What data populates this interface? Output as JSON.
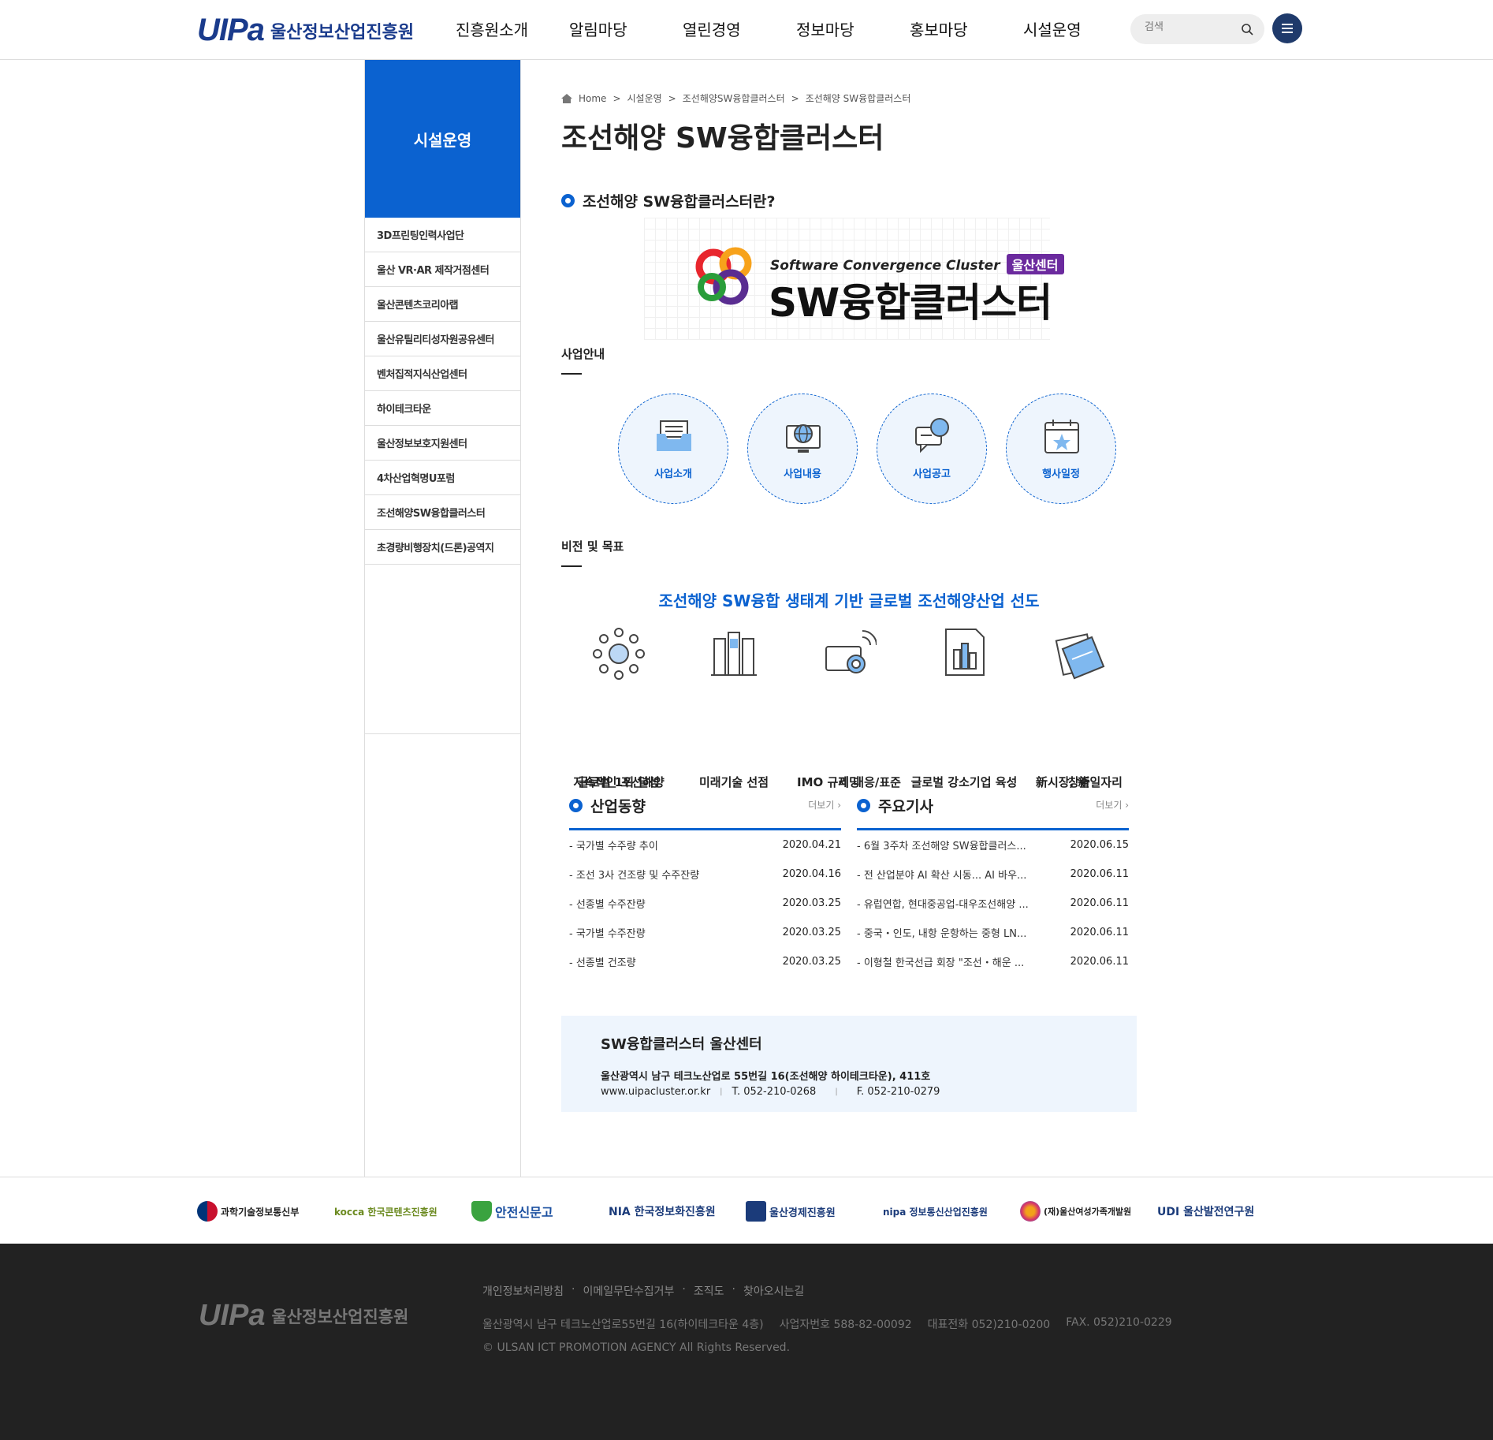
{
  "header": {
    "logo_mark": "UIPa",
    "logo_text": "울산정보산업진흥원",
    "nav": [
      "진흥원소개",
      "알림마당",
      "열린경영",
      "정보마당",
      "홍보마당",
      "시설운영"
    ],
    "search_placeholder": "검색"
  },
  "sidebar": {
    "title": "시설운영",
    "items": [
      "3D프린팅인력사업단",
      "울산 VR·AR 제작거점센터",
      "울산콘텐츠코리아랩",
      "울산유틸리티성자원공유센터",
      "벤처집적지식산업센터",
      "하이테크타운",
      "울산정보보호지원센터",
      "4차산업혁명U포럼",
      "조선해양SW융합클러스터",
      "초경량비행장치(드론)공역지"
    ]
  },
  "breadcrumb": [
    "Home",
    "시설운영",
    "조선해양SW융합클러스터",
    "조선해양 SW융합클러스터"
  ],
  "page_title": "조선해양 SW융합클러스터",
  "intro": {
    "heading": "조선해양 SW융합클러스터란?",
    "banner_sub": "Software Convergence Cluster",
    "banner_tag": "울산센터",
    "banner_main": "SW융합클러스터"
  },
  "business": {
    "heading": "사업안내",
    "items": [
      {
        "label": "사업소개",
        "icon": "inbox-icon"
      },
      {
        "label": "사업내용",
        "icon": "monitor-globe-icon"
      },
      {
        "label": "사업공고",
        "icon": "chat-search-icon"
      },
      {
        "label": "행사일정",
        "icon": "calendar-star-icon"
      }
    ]
  },
  "vision": {
    "heading": "비전 및 목표",
    "statement": "조선해양 SW융합 생태계 기반 글로벌 조선해양산업 선도",
    "goals": [
      {
        "line1": "지속적인 조선해양",
        "line2": "글로벌 1위 달성",
        "icon": "network-icon"
      },
      {
        "line1": "미래기술 선점",
        "line2": "",
        "icon": "books-icon"
      },
      {
        "line1": "IMO 규제 대응/표준",
        "line2": "리딩",
        "icon": "camera-signal-icon"
      },
      {
        "line1": "글로벌 강소기업 육성",
        "line2": "",
        "icon": "building-doc-icon"
      },
      {
        "line1": "新시장, 新일자리",
        "line2": "창출",
        "icon": "notes-icon"
      }
    ]
  },
  "boards": [
    {
      "title": "산업동향",
      "more": "더보기 ›",
      "rows": [
        {
          "title": "국가별 수주량 추이",
          "date": "2020.04.21"
        },
        {
          "title": "조선 3사 건조량 및 수주잔량",
          "date": "2020.04.16"
        },
        {
          "title": "선종별 수주잔량",
          "date": "2020.03.25"
        },
        {
          "title": "국가별 수주잔량",
          "date": "2020.03.25"
        },
        {
          "title": "선종별 건조량",
          "date": "2020.03.25"
        }
      ]
    },
    {
      "title": "주요기사",
      "more": "더보기 ›",
      "rows": [
        {
          "title": "6월 3주차 조선해양 SW융합클러스...",
          "date": "2020.06.15"
        },
        {
          "title": "전 산업분야 AI 확산 시동... AI 바우...",
          "date": "2020.06.11"
        },
        {
          "title": "유럽연합, 현대중공업-대우조선해양 ...",
          "date": "2020.06.11"
        },
        {
          "title": "중국・인도, 내항 운항하는 중형 LN...",
          "date": "2020.06.11"
        },
        {
          "title": "이형철 한국선급 회장 \"조선・해운 ...",
          "date": "2020.06.11"
        }
      ]
    }
  ],
  "contact": {
    "title": "SW융합클러스터 울산센터",
    "address": "울산광역시 남구 테크노산업로 55번길 16(조선해양 하이테크타운), 411호",
    "website": "www.uipacluster.or.kr",
    "tel": "T. 052-210-0268",
    "fax": "F. 052-210-0279"
  },
  "partners": [
    "과학기술정보통신부",
    "kocca 한국콘텐츠진흥원",
    "안전신문고",
    "NIA 한국정보화진흥원",
    "울산경제진흥원",
    "nipa 정보통신산업진흥원",
    "(재)울산여성가족개발원",
    "UDI 울산발전연구원"
  ],
  "footer": {
    "logo_mark": "UIPa",
    "logo_text": "울산정보산업진흥원",
    "links": [
      "개인정보처리방침",
      "이메일무단수집거부",
      "조직도",
      "찾아오시는길"
    ],
    "address": "울산광역시 남구 테크노산업로55번길 16(하이테크타운 4층)",
    "bizno": "사업자번호 588-82-00092",
    "tel": "대표전화 052)210-0200",
    "fax": "FAX. 052)210-0229",
    "copyright": "© ULSAN ICT PROMOTION AGENCY All Rights Reserved."
  },
  "colors": {
    "accent": "#0b62d0",
    "navy": "#1a3b8c",
    "footer_bg": "#222222"
  }
}
